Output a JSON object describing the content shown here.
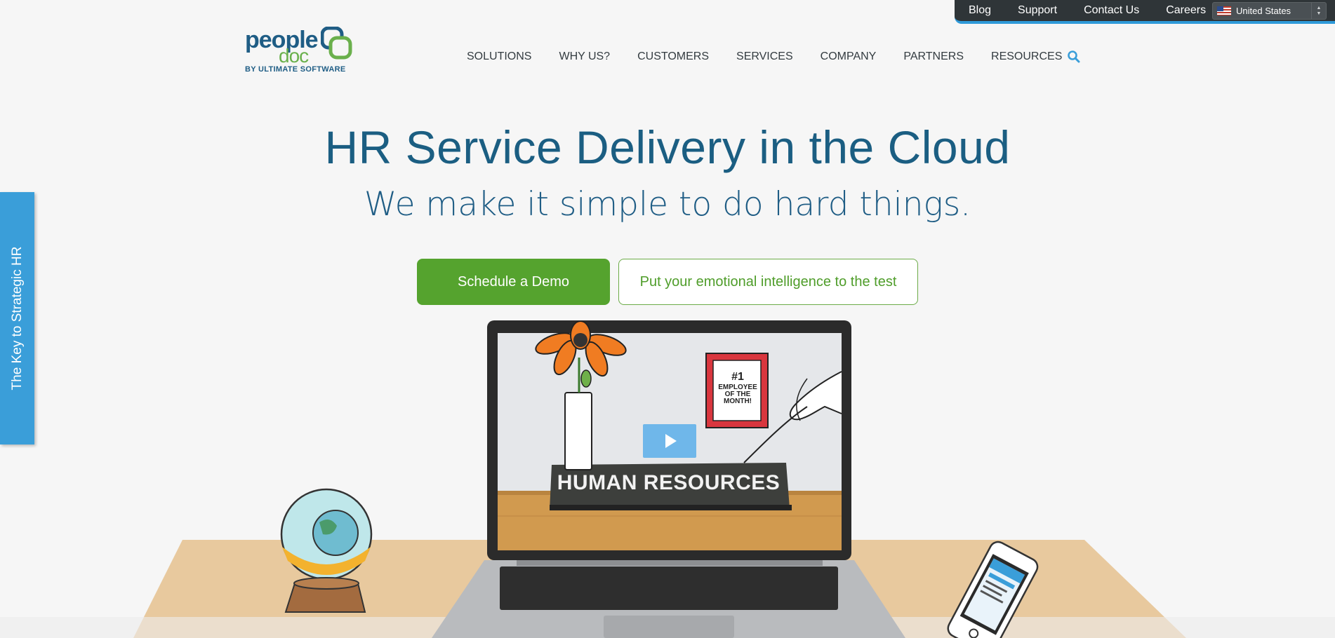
{
  "utility_nav": {
    "links": [
      "Blog",
      "Support",
      "Contact Us",
      "Careers"
    ],
    "country": "United States"
  },
  "logo": {
    "line1": "people",
    "line2": "doc",
    "byline": "BY ULTIMATE SOFTWARE"
  },
  "main_nav": {
    "items": [
      "SOLUTIONS",
      "WHY US?",
      "CUSTOMERS",
      "SERVICES",
      "COMPANY",
      "PARTNERS",
      "RESOURCES"
    ]
  },
  "hero": {
    "title": "HR Service Delivery in the Cloud",
    "subtitle": "We make it simple to do hard things.",
    "primary_button": "Schedule a Demo",
    "secondary_button": "Put your emotional intelligence to the test"
  },
  "side_tab": {
    "label": "The Key to Strategic HR"
  },
  "video": {
    "sign_text": "HUMAN RESOURCES",
    "frame_number": "#1",
    "frame_caption": "EMPLOYEE OF THE MONTH!"
  },
  "icons": [
    "search-icon",
    "play-icon",
    "flag-icon",
    "select-arrows-icon"
  ],
  "colors": {
    "brand_blue": "#1b5e82",
    "accent_blue": "#3a9ed9",
    "brand_green": "#55a32e",
    "utility_bar": "#2f3538"
  }
}
